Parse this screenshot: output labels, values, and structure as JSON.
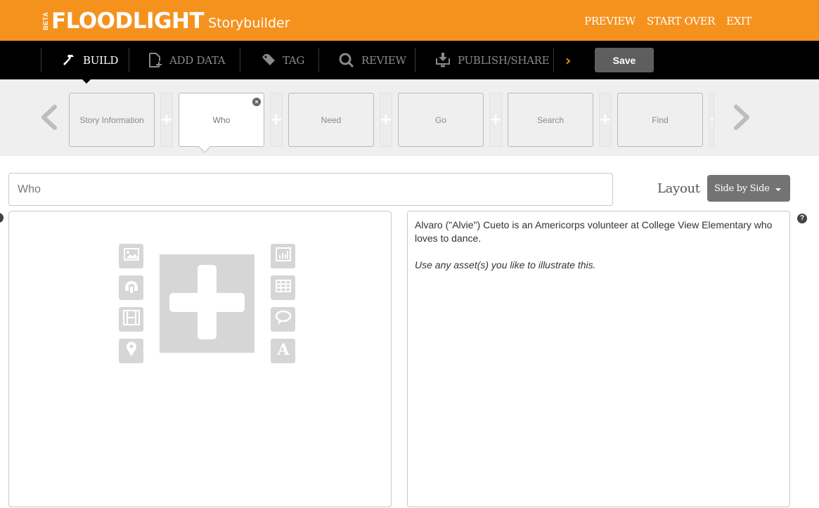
{
  "header": {
    "beta_label": "BETA",
    "brand": "FLOODLIGHT",
    "product": "Storybuilder",
    "links": [
      "PREVIEW",
      "START OVER",
      "EXIT"
    ]
  },
  "nav": {
    "items": [
      {
        "label": "BUILD",
        "icon": "hammer-icon",
        "active": true
      },
      {
        "label": "ADD DATA",
        "icon": "add-document-icon",
        "active": false
      },
      {
        "label": "TAG",
        "icon": "tag-icon",
        "active": false
      },
      {
        "label": "REVIEW",
        "icon": "search-icon",
        "active": false
      },
      {
        "label": "PUBLISH/SHARE",
        "icon": "download-monitor-icon",
        "active": false
      }
    ],
    "next_arrow": "›",
    "save_label": "Save",
    "accent_color": "#f5921e"
  },
  "sections": {
    "cards": [
      {
        "label": "Story Information",
        "active": false
      },
      {
        "label": "Who",
        "active": true
      },
      {
        "label": "Need",
        "active": false
      },
      {
        "label": "Go",
        "active": false
      },
      {
        "label": "Search",
        "active": false
      },
      {
        "label": "Find",
        "active": false
      }
    ],
    "remove_label": "×",
    "add_label": "+"
  },
  "editor": {
    "title_value": "Who",
    "layout_label": "Layout",
    "layout_selected": "Side by Side",
    "help_label": "?",
    "text_paragraph": "Alvaro (\"Alvie\") Cueto is an Americorps volunteer at College View Elementary who loves to dance.",
    "text_italic": "Use any asset(s) you like to illustrate this.",
    "asset_buttons_left": [
      "image-icon",
      "audio-icon",
      "video-icon",
      "map-pin-icon"
    ],
    "asset_buttons_right": [
      "chart-icon",
      "table-icon",
      "quote-icon",
      "text-icon"
    ]
  }
}
